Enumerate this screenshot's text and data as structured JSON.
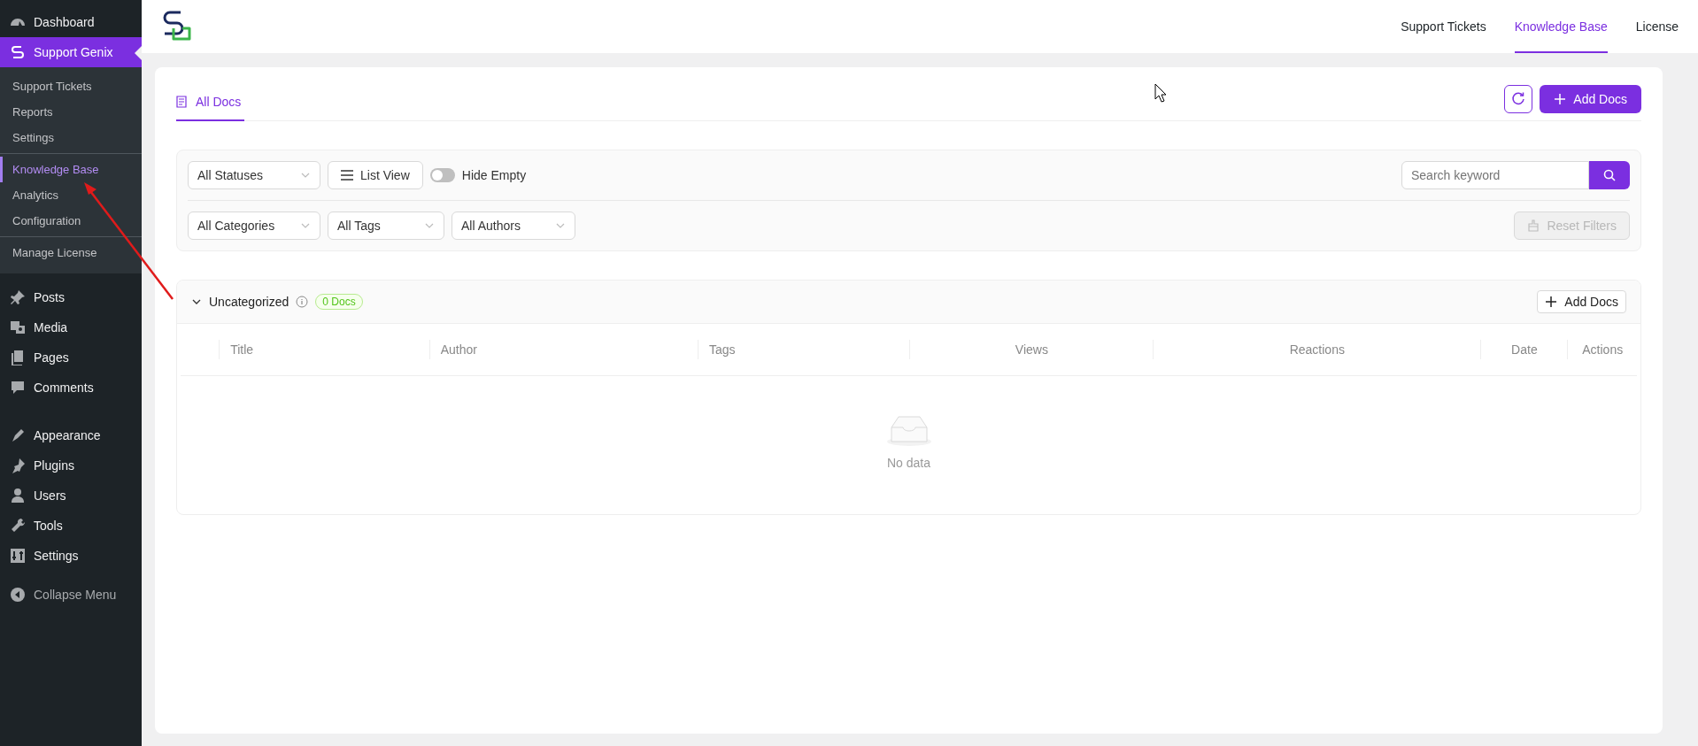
{
  "sidebar": {
    "top_items": [
      {
        "label": "Dashboard",
        "selected": false
      },
      {
        "label": "Support Genix",
        "selected": true
      }
    ],
    "submenu_groups": [
      [
        {
          "label": "Support Tickets",
          "selected": false
        },
        {
          "label": "Reports",
          "selected": false
        },
        {
          "label": "Settings",
          "selected": false
        }
      ],
      [
        {
          "label": "Knowledge Base",
          "selected": true
        },
        {
          "label": "Analytics",
          "selected": false
        },
        {
          "label": "Configuration",
          "selected": false
        }
      ],
      [
        {
          "label": "Manage License",
          "selected": false
        }
      ]
    ],
    "menu_groups": [
      [
        {
          "label": "Posts"
        },
        {
          "label": "Media"
        },
        {
          "label": "Pages"
        },
        {
          "label": "Comments"
        }
      ],
      [
        {
          "label": "Appearance"
        },
        {
          "label": "Plugins"
        },
        {
          "label": "Users"
        },
        {
          "label": "Tools"
        },
        {
          "label": "Settings"
        }
      ]
    ],
    "collapse": "Collapse Menu"
  },
  "header": {
    "nav": [
      {
        "label": "Support Tickets",
        "selected": false
      },
      {
        "label": "Knowledge Base",
        "selected": true
      },
      {
        "label": "License",
        "selected": false
      }
    ]
  },
  "tabs": [
    {
      "label": "All Docs",
      "selected": true
    }
  ],
  "toolbar": {
    "add_button": "Add Docs"
  },
  "filters": {
    "status": "All Statuses",
    "view_button": "List View",
    "hide_empty": {
      "label": "Hide Empty",
      "on": false
    },
    "search": {
      "placeholder": "Search keyword"
    },
    "categories": "All Categories",
    "tags": "All Tags",
    "authors": "All Authors",
    "reset": {
      "label": "Reset Filters",
      "disabled": true
    }
  },
  "category": {
    "name": "Uncategorized",
    "expanded": true,
    "count": "0 Docs",
    "add_button": "Add Docs",
    "columns": [
      {
        "label": "Title"
      },
      {
        "label": "Author"
      },
      {
        "label": "Tags"
      },
      {
        "label": "Views"
      },
      {
        "label": "Reactions"
      },
      {
        "label": "Date"
      },
      {
        "label": "Actions"
      }
    ],
    "empty_text": "No data"
  }
}
